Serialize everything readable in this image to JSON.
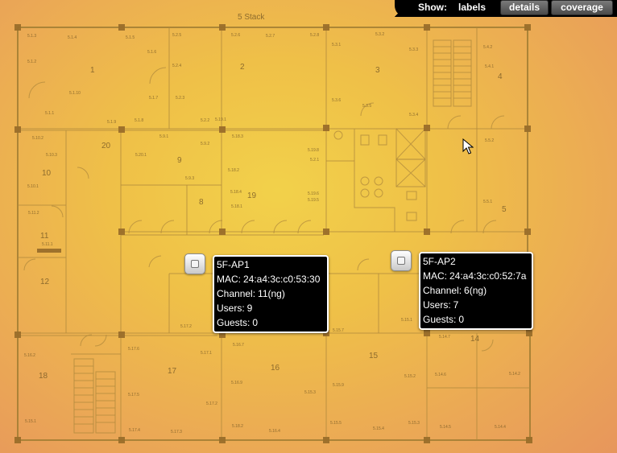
{
  "toolbar": {
    "show_label": "Show:",
    "labels_link": "labels",
    "details_button": "details",
    "coverage_button": "coverage"
  },
  "floorplan": {
    "title": "5 Stack",
    "rooms": [
      {
        "label": "1"
      },
      {
        "label": "2"
      },
      {
        "label": "3"
      },
      {
        "label": "4"
      },
      {
        "label": "5"
      },
      {
        "label": "20"
      },
      {
        "label": "9"
      },
      {
        "label": "19"
      },
      {
        "label": "8"
      },
      {
        "label": "10"
      },
      {
        "label": "11"
      },
      {
        "label": "12"
      },
      {
        "label": "18"
      },
      {
        "label": "17"
      },
      {
        "label": "16"
      },
      {
        "label": "15"
      },
      {
        "label": "14"
      }
    ],
    "sublabels": [
      "5.1.3",
      "5.1.4",
      "5.1.5",
      "5.2.5",
      "5.2.6",
      "5.2.7",
      "5.2.8",
      "5.3.2",
      "5.4.2",
      "5.1.2",
      "5.1.6",
      "5.2.4",
      "5.3.1",
      "5.3.3",
      "5.4.1",
      "5.1.10",
      "5.1.7",
      "5.2.3",
      "5.1.1",
      "5.3.6",
      "5.3.5",
      "5.3.4",
      "5.1.9",
      "5.1.8",
      "5.2.2",
      "5.19.1",
      "5.10.2",
      "5.9.1",
      "5.18.3",
      "5.5.2",
      "5.10.3",
      "5.20.1",
      "5.9.2",
      "5.19.8",
      "5.2.1",
      "5.18.2",
      "5.9.3",
      "5.10.1",
      "5.19.6",
      "5.18.4",
      "5.19.5",
      "5.5.1",
      "5.11.2",
      "5.18.1",
      "5.11.1",
      "5.17.2",
      "5.16.2",
      "5.15.7",
      "5.15.1",
      "5.14.7",
      "5.17.6",
      "5.17.1",
      "5.16.7",
      "5.16.2",
      "5.17.5",
      "5.16.9",
      "5.15.9",
      "5.15.3",
      "5.15.2",
      "5.14.6",
      "5.14.2",
      "5.17.2",
      "5.15.1",
      "5.15.5",
      "5.15.3",
      "5.14.5",
      "5.14.4",
      "5.17.4",
      "5.17.3",
      "5.16.4",
      "5.15.4",
      "5.18.2"
    ]
  },
  "access_points": [
    {
      "name": "5F-AP1",
      "mac_label": "MAC:",
      "mac": "24:a4:3c:c0:53:30",
      "channel_label": "Channel:",
      "channel": "11(ng)",
      "users_label": "Users:",
      "users": "9",
      "guests_label": "Guests:",
      "guests": "0"
    },
    {
      "name": "5F-AP2",
      "mac_label": "MAC:",
      "mac": "24:a4:3c:c0:52:7a",
      "channel_label": "Channel:",
      "channel": "6(ng)",
      "users_label": "Users:",
      "users": "7",
      "guests_label": "Guests:",
      "guests": "0"
    }
  ],
  "colors": {
    "map_center": "#f2d14a",
    "map_edge": "#e7965c",
    "wall": "#a07c33",
    "card_bg": "#000000",
    "card_text": "#ffffff"
  }
}
